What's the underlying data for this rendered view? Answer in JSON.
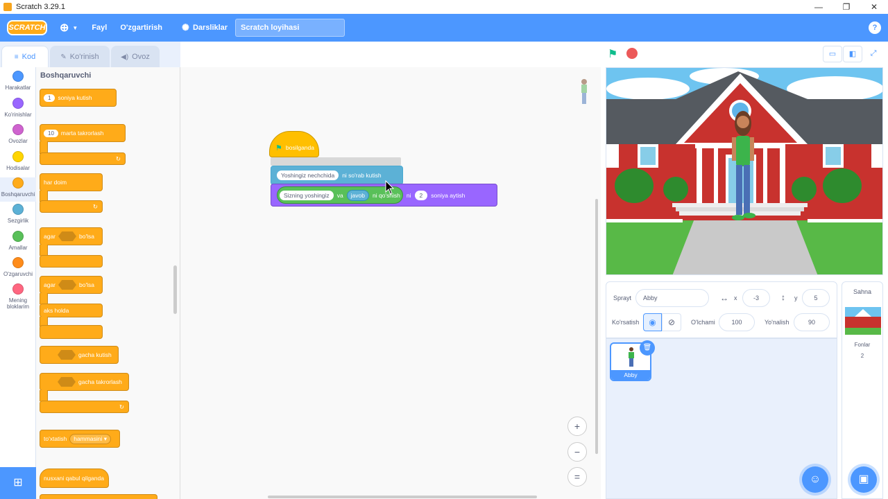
{
  "window": {
    "title": "Scratch 3.29.1",
    "controls": [
      "—",
      "❐",
      "✕"
    ]
  },
  "menubar": {
    "logo": "SCRATCH",
    "globe": "⊕",
    "file": "Fayl",
    "edit": "O'zgartirish",
    "tutorials": "Darsliklar",
    "project_title": "Scratch loyihasi",
    "help": "?"
  },
  "tabs": [
    {
      "label": "Kod"
    },
    {
      "label": "Ko'rinish"
    },
    {
      "label": "Ovoz"
    }
  ],
  "categories": [
    {
      "label": "Harakatlar",
      "color": "#4c97ff"
    },
    {
      "label": "Ko'rinishlar",
      "color": "#9966ff"
    },
    {
      "label": "Ovozlar",
      "color": "#cf63cf"
    },
    {
      "label": "Hodisalar",
      "color": "#ffd500"
    },
    {
      "label": "Boshqaruvchi",
      "color": "#ffab19"
    },
    {
      "label": "Sezgirlik",
      "color": "#5cb1d6"
    },
    {
      "label": "Amallar",
      "color": "#59c059"
    },
    {
      "label": "O'zgaruvchi",
      "color": "#ff8c1a"
    },
    {
      "label": "Mening bloklarim",
      "color": "#ff6680"
    }
  ],
  "palette": {
    "title": "Boshqaruvchi",
    "wait_value": "1",
    "wait_label": "soniya kutish",
    "repeat_value": "10",
    "repeat_label": "marta takrorlash",
    "forever": "har doim",
    "if_label": "agar",
    "then_label": "bo'lsa",
    "else_label": "aks holda",
    "wait_until": "gacha kutish",
    "repeat_until": "gacha takrorlash",
    "stop_label": "to'xtatish",
    "stop_option": "hammasini ▾",
    "clone_start": "nusxani qabul qilganda"
  },
  "script": {
    "hat_label": "bosilganda",
    "ask_input": "Yoshingiz nechchida",
    "ask_label": "ni so'rab kutish",
    "say_join_1": "Sizning yoshingiz",
    "say_and": "va",
    "answer": "javob",
    "join_label": "ni qo'shish",
    "say_ni": "ni",
    "say_secs": "2",
    "say_label": "soniya aytish"
  },
  "zoom": {
    "in": "+",
    "out": "−",
    "reset": "="
  },
  "sprite_info": {
    "sprite_label": "Sprayt",
    "sprite_name": "Abby",
    "x_label": "x",
    "x_value": "-3",
    "y_label": "y",
    "y_value": "5",
    "show_label": "Ko'rsatish",
    "size_label": "O'lchami",
    "size_value": "100",
    "direction_label": "Yo'nalish",
    "direction_value": "90"
  },
  "sprites": [
    {
      "name": "Abby"
    }
  ],
  "stage_panel": {
    "title": "Sahna",
    "backdrops_label": "Fonlar",
    "backdrops_count": "2"
  }
}
